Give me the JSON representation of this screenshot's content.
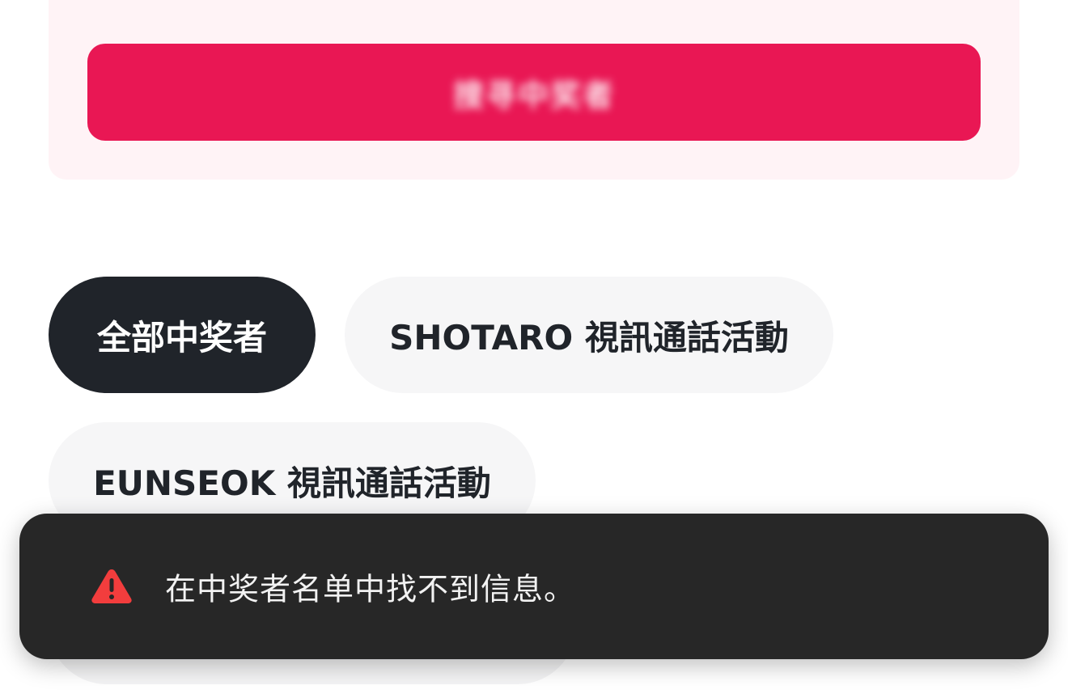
{
  "search": {
    "button_label": "搜寻中奖者"
  },
  "filters": {
    "chips": [
      {
        "label": "全部中奖者",
        "active": true
      },
      {
        "label": "SHOTARO 視訊通話活動",
        "active": false
      },
      {
        "label": "EUNSEOK 視訊通話活動",
        "active": false
      }
    ]
  },
  "toast": {
    "icon": "warning-icon",
    "message": "在中奖者名单中找不到信息。"
  },
  "colors": {
    "accent": "#e91754",
    "card_bg": "#fff3f6",
    "chip_active_bg": "#20242a",
    "chip_bg": "#f6f6f7",
    "toast_bg": "#272727",
    "warning": "#f23d3d"
  }
}
